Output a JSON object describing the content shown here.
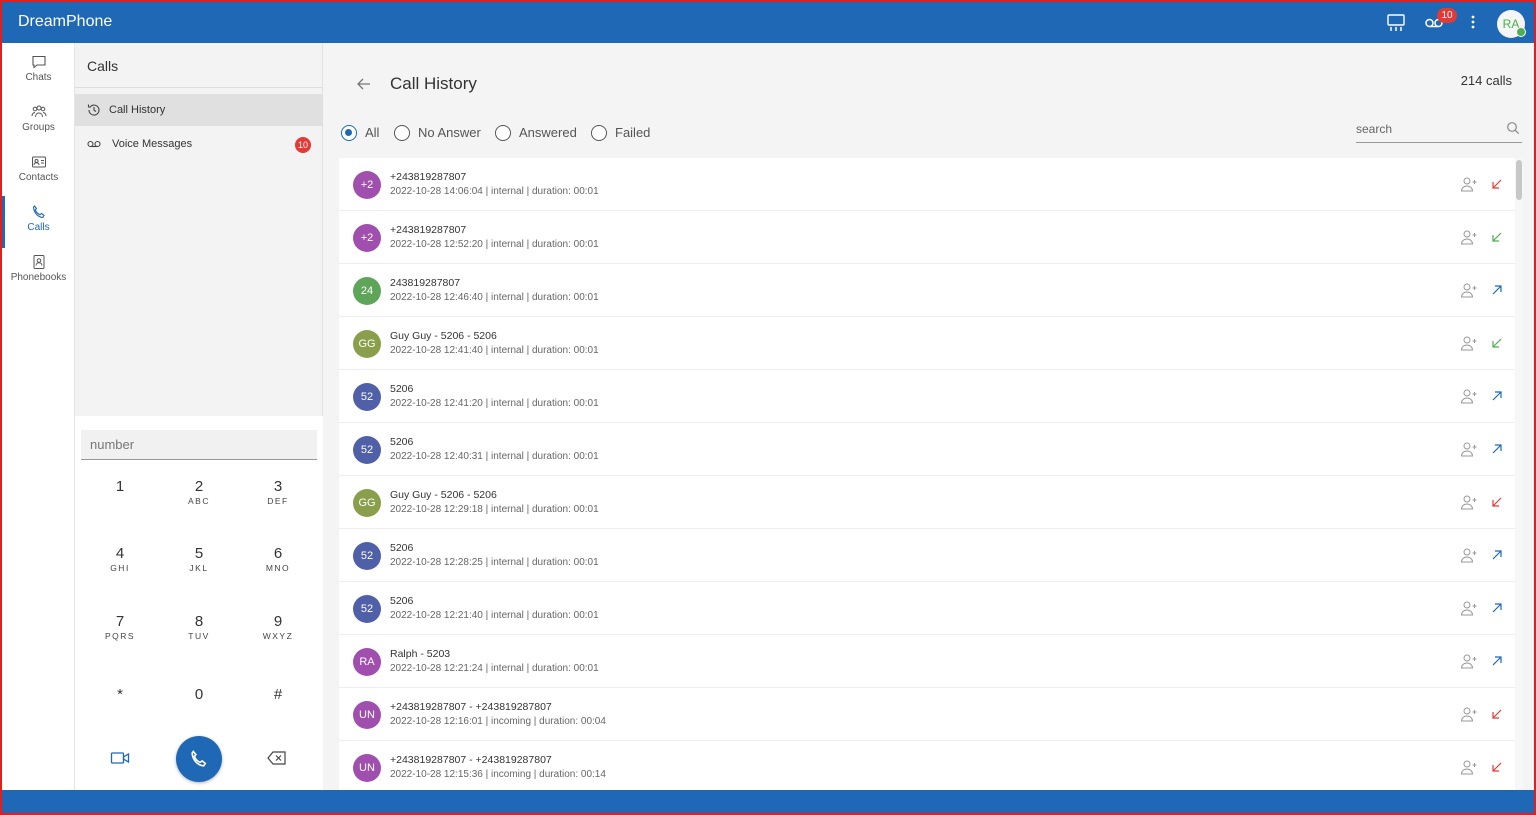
{
  "app": {
    "title": "DreamPhone"
  },
  "topbar": {
    "voicemail_badge": "10",
    "avatar_initials": "RA"
  },
  "rail": {
    "items": [
      {
        "label": "Chats",
        "icon": "chat-icon"
      },
      {
        "label": "Groups",
        "icon": "groups-icon"
      },
      {
        "label": "Contacts",
        "icon": "contacts-icon"
      },
      {
        "label": "Calls",
        "icon": "phone-icon",
        "active": true
      },
      {
        "label": "Phonebooks",
        "icon": "phonebook-icon"
      }
    ]
  },
  "calls_panel": {
    "title": "Calls",
    "items": [
      {
        "label": "Call History",
        "icon": "history-icon",
        "active": true
      },
      {
        "label": "Voice Messages",
        "icon": "voicemail-icon",
        "badge": "10"
      }
    ]
  },
  "dialer": {
    "placeholder": "number",
    "keys": [
      {
        "digit": "1",
        "letters": ""
      },
      {
        "digit": "2",
        "letters": "ABC"
      },
      {
        "digit": "3",
        "letters": "DEF"
      },
      {
        "digit": "4",
        "letters": "GHI"
      },
      {
        "digit": "5",
        "letters": "JKL"
      },
      {
        "digit": "6",
        "letters": "MNO"
      },
      {
        "digit": "7",
        "letters": "PQRS"
      },
      {
        "digit": "8",
        "letters": "TUV"
      },
      {
        "digit": "9",
        "letters": "WXYZ"
      },
      {
        "digit": "*",
        "letters": ""
      },
      {
        "digit": "0",
        "letters": ""
      },
      {
        "digit": "#",
        "letters": ""
      }
    ]
  },
  "main": {
    "title": "Call History",
    "count": "214 calls",
    "filters": [
      {
        "label": "All",
        "selected": true
      },
      {
        "label": "No Answer",
        "selected": false
      },
      {
        "label": "Answered",
        "selected": false
      },
      {
        "label": "Failed",
        "selected": false
      }
    ],
    "search_placeholder": "search"
  },
  "colors": {
    "brand": "#1f68b6",
    "badge": "#e53935",
    "incoming": "#e53935",
    "answered": "#4caf50",
    "outgoing": "#1f68b6"
  },
  "calls": [
    {
      "initials": "+2",
      "color": "#a14fae",
      "name": "+243819287807",
      "info": "2022-10-28 14:06:04 | internal | duration: 00:01",
      "direction": "missed"
    },
    {
      "initials": "+2",
      "color": "#a14fae",
      "name": "+243819287807",
      "info": "2022-10-28 12:52:20 | internal | duration: 00:01",
      "direction": "received"
    },
    {
      "initials": "24",
      "color": "#5ea55a",
      "name": "243819287807",
      "info": "2022-10-28 12:46:40 | internal | duration: 00:01",
      "direction": "outgoing"
    },
    {
      "initials": "GG",
      "color": "#8a9f4c",
      "name": "Guy Guy - 5206  - 5206",
      "info": "2022-10-28 12:41:40 | internal | duration: 00:01",
      "direction": "received"
    },
    {
      "initials": "52",
      "color": "#5060a8",
      "name": "5206",
      "info": "2022-10-28 12:41:20 | internal | duration: 00:01",
      "direction": "outgoing"
    },
    {
      "initials": "52",
      "color": "#5060a8",
      "name": "5206",
      "info": "2022-10-28 12:40:31 | internal | duration: 00:01",
      "direction": "outgoing"
    },
    {
      "initials": "GG",
      "color": "#8a9f4c",
      "name": "Guy Guy - 5206  - 5206",
      "info": "2022-10-28 12:29:18 | internal | duration: 00:01",
      "direction": "missed"
    },
    {
      "initials": "52",
      "color": "#5060a8",
      "name": "5206",
      "info": "2022-10-28 12:28:25 | internal | duration: 00:01",
      "direction": "outgoing"
    },
    {
      "initials": "52",
      "color": "#5060a8",
      "name": "5206",
      "info": "2022-10-28 12:21:40 | internal | duration: 00:01",
      "direction": "outgoing"
    },
    {
      "initials": "RA",
      "color": "#a14fae",
      "name": "Ralph  - 5203",
      "info": "2022-10-28 12:21:24 | internal | duration: 00:01",
      "direction": "outgoing"
    },
    {
      "initials": "UN",
      "color": "#a14fae",
      "name": "+243819287807  - +243819287807",
      "info": "2022-10-28 12:16:01 | incoming | duration: 00:04",
      "direction": "missed"
    },
    {
      "initials": "UN",
      "color": "#a14fae",
      "name": "+243819287807  - +243819287807",
      "info": "2022-10-28 12:15:36 | incoming | duration: 00:14",
      "direction": "missed"
    }
  ]
}
